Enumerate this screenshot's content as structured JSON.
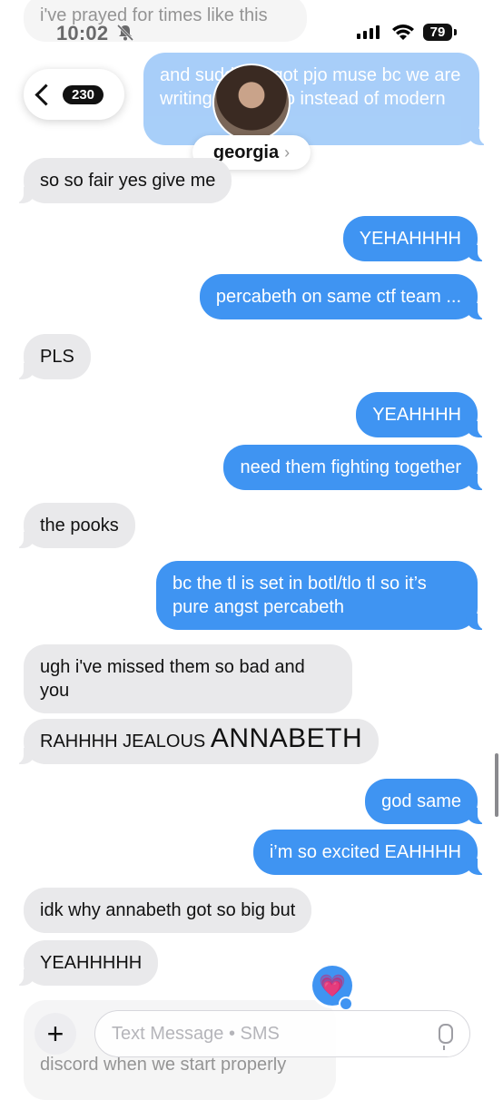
{
  "status": {
    "time": "10:02",
    "battery": "79"
  },
  "header": {
    "back_count": "230",
    "contact_name": "georgia",
    "chevron": "›"
  },
  "messages": [
    {
      "dir": "in",
      "text": "i've prayed for times like this"
    },
    {
      "dir": "out",
      "text": "and suddenly got pjo muse bc we are writing actual pjo instead of modern"
    },
    {
      "dir": "in",
      "text": "so so fair yes give me"
    },
    {
      "dir": "out",
      "text": "YEHAHHHH"
    },
    {
      "dir": "out",
      "text": "percabeth on same ctf team ..."
    },
    {
      "dir": "in",
      "text": "PLS"
    },
    {
      "dir": "out",
      "text": "YEAHHHH"
    },
    {
      "dir": "out",
      "text": "need them fighting together"
    },
    {
      "dir": "in",
      "text": "the pooks"
    },
    {
      "dir": "out",
      "text": "bc the tl is set in botl/tlo tl so it’s pure angst percabeth"
    },
    {
      "dir": "in",
      "text": "ugh i've missed them so bad and you"
    },
    {
      "dir": "in",
      "text_a": "RAHHHH JEALOUS ",
      "text_b": "ANNABETH"
    },
    {
      "dir": "out",
      "text": "god same"
    },
    {
      "dir": "out",
      "text": "i’m so excited EAHHHH"
    },
    {
      "dir": "in",
      "text": "idk why annabeth got so big but"
    },
    {
      "dir": "in",
      "text": "YEAHHHHH"
    },
    {
      "dir": "in",
      "text": "discord when we start properly"
    }
  ],
  "input": {
    "placeholder": "Text Message • SMS",
    "plus": "+"
  },
  "reaction": {
    "emoji": "💗"
  }
}
